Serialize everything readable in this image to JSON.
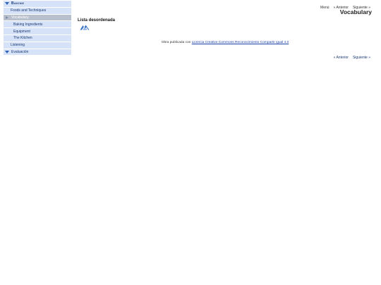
{
  "sidebar": {
    "items": [
      {
        "label": "Baking"
      },
      {
        "label": "Foods and Techniques"
      },
      {
        "label": "Vocabulary"
      },
      {
        "label": "Baking Ingredients"
      },
      {
        "label": "Equipment"
      },
      {
        "label": "The Kitchen"
      },
      {
        "label": "Listening"
      },
      {
        "label": "Evaluación"
      }
    ]
  },
  "topnav": {
    "menu": "Menú",
    "prev": "« Anterior",
    "next": "Siguiente »"
  },
  "page_title": "Vocabulary",
  "content": {
    "section_title": "Lista desordenada",
    "logo_icon": "mountain-logo-icon"
  },
  "license": {
    "prefix": "Obra publicada con",
    "link_text": "Licencia Creative Commons Reconocimiento Compartir igual 4.0"
  },
  "bottomnav": {
    "prev": "« Anterior",
    "next": "Siguiente »"
  },
  "colors": {
    "nav_bg": "#d5e2f7",
    "nav_active": "#b8c0cd",
    "link": "#1a3fa8"
  }
}
